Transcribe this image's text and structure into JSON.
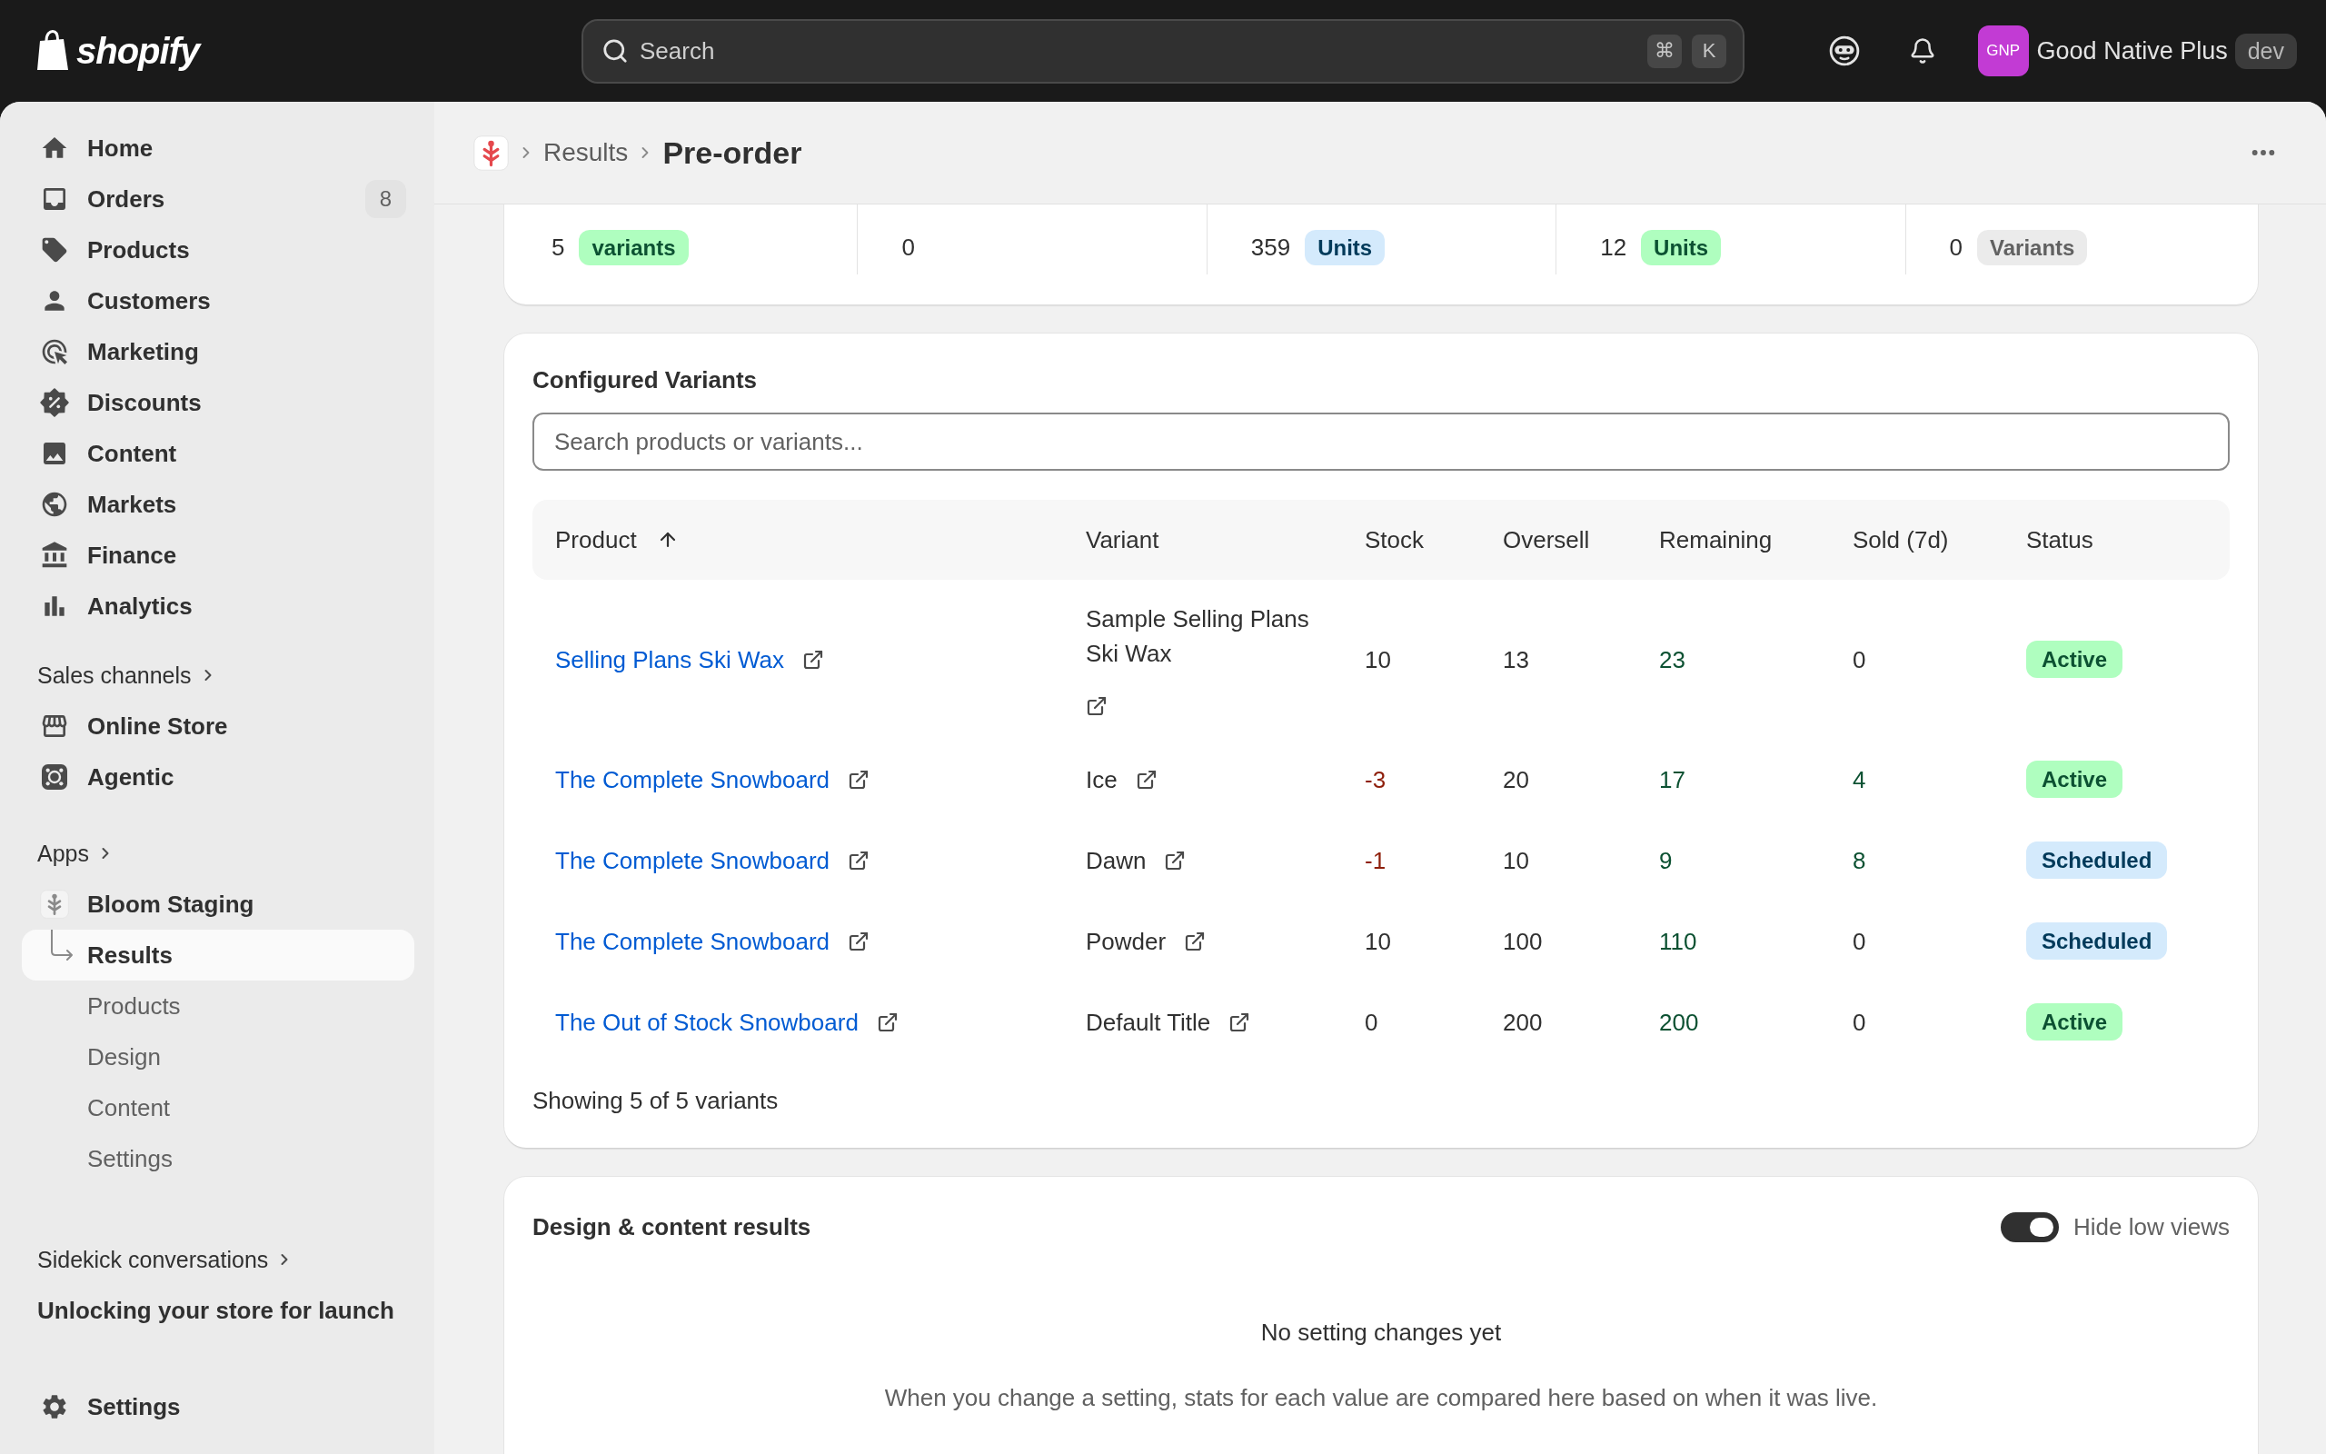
{
  "top_bar": {
    "logo": "shopify",
    "search": {
      "placeholder": "Search",
      "shortcut": [
        "⌘",
        "K"
      ]
    },
    "store": {
      "initials": "GNP",
      "name": "Good Native Plus",
      "environment": "dev"
    }
  },
  "sidebar": {
    "items": [
      {
        "label": "Home",
        "selected": false
      },
      {
        "label": "Orders",
        "badge": "8",
        "selected": false
      },
      {
        "label": "Products",
        "selected": false
      },
      {
        "label": "Customers",
        "selected": false
      },
      {
        "label": "Marketing",
        "selected": false
      },
      {
        "label": "Discounts",
        "selected": false
      },
      {
        "label": "Content",
        "selected": false
      },
      {
        "label": "Markets",
        "selected": false
      },
      {
        "label": "Finance",
        "selected": false
      },
      {
        "label": "Analytics",
        "selected": false
      }
    ],
    "sales_channels": {
      "title": "Sales channels",
      "items": [
        {
          "label": "Online Store",
          "selected": false
        },
        {
          "label": "Agentic",
          "selected": false
        }
      ]
    },
    "apps": {
      "title": "Apps",
      "items": [
        {
          "label": "Bloom Staging",
          "selected": false,
          "children": [
            {
              "label": "Results",
              "selected": true
            },
            {
              "label": "Products",
              "selected": false
            },
            {
              "label": "Design",
              "selected": false
            },
            {
              "label": "Content",
              "selected": false
            },
            {
              "label": "Settings",
              "selected": false
            }
          ]
        }
      ]
    },
    "sidekick": {
      "title": "Sidekick conversations",
      "items": [
        {
          "label": "Unlocking your store for launch",
          "selected": false
        }
      ]
    },
    "settings": {
      "label": "Settings",
      "selected": false
    }
  },
  "page_header": {
    "breadcrumbs": [
      "Results"
    ],
    "title": "Pre-order"
  },
  "stats": [
    {
      "value": "5",
      "badge": {
        "label": "variants",
        "kind": "success"
      }
    },
    {
      "value": "0"
    },
    {
      "value": "359",
      "badge": {
        "label": "Units",
        "kind": "info"
      }
    },
    {
      "value": "12",
      "badge": {
        "label": "Units",
        "kind": "success"
      }
    },
    {
      "value": "0",
      "badge": {
        "label": "Variants",
        "kind": "neutral"
      }
    }
  ],
  "variants_card": {
    "title": "Configured Variants",
    "search": {
      "placeholder": "Search products or variants..."
    },
    "columns": [
      {
        "label": "Product",
        "sorted": true,
        "descending": false
      },
      {
        "label": "Variant",
        "sorted": false
      },
      {
        "label": "Stock",
        "sorted": false
      },
      {
        "label": "Oversell",
        "sorted": false
      },
      {
        "label": "Remaining",
        "sorted": false
      },
      {
        "label": "Sold (7d)",
        "sorted": false
      },
      {
        "label": "Status",
        "sorted": false
      }
    ],
    "rows": [
      {
        "product": "Selling Plans Ski Wax",
        "variant": "Sample Selling Plans Ski Wax",
        "stock": {
          "value": "10"
        },
        "oversell": {
          "value": "13"
        },
        "remaining": {
          "value": "23",
          "color": "#0c5132"
        },
        "sold": {
          "value": "0"
        },
        "status": {
          "label": "Active",
          "kind": "success"
        }
      },
      {
        "product": "The Complete Snowboard",
        "variant": "Ice",
        "stock": {
          "value": "-3",
          "color": "#8e1f0b"
        },
        "oversell": {
          "value": "20"
        },
        "remaining": {
          "value": "17",
          "color": "#0c5132"
        },
        "sold": {
          "value": "4",
          "color": "#0c5132"
        },
        "status": {
          "label": "Active",
          "kind": "success"
        }
      },
      {
        "product": "The Complete Snowboard",
        "variant": "Dawn",
        "stock": {
          "value": "-1",
          "color": "#8e1f0b"
        },
        "oversell": {
          "value": "10"
        },
        "remaining": {
          "value": "9",
          "color": "#0c5132"
        },
        "sold": {
          "value": "8",
          "color": "#0c5132"
        },
        "status": {
          "label": "Scheduled",
          "kind": "info"
        }
      },
      {
        "product": "The Complete Snowboard",
        "variant": "Powder",
        "stock": {
          "value": "10"
        },
        "oversell": {
          "value": "100"
        },
        "remaining": {
          "value": "110",
          "color": "#0c5132"
        },
        "sold": {
          "value": "0"
        },
        "status": {
          "label": "Scheduled",
          "kind": "info"
        }
      },
      {
        "product": "The Out of Stock Snowboard",
        "variant": "Default Title",
        "stock": {
          "value": "0"
        },
        "oversell": {
          "value": "200"
        },
        "remaining": {
          "value": "200",
          "color": "#0c5132"
        },
        "sold": {
          "value": "0"
        },
        "status": {
          "label": "Active",
          "kind": "success"
        }
      }
    ],
    "footer": "Showing 5 of 5 variants"
  },
  "design_card": {
    "title": "Design & content results",
    "toggle": {
      "label": "Hide low views",
      "on": true
    },
    "empty_state": {
      "title": "No setting changes yet",
      "description": "When you change a setting, stats for each value are compared here based on when it was live."
    }
  }
}
